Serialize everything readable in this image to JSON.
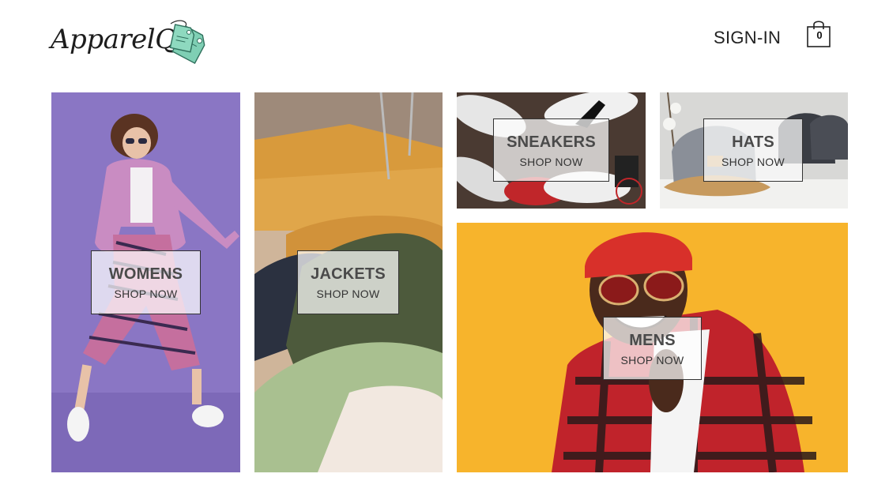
{
  "header": {
    "logo_text": "ApparelQ",
    "signin_label": "SIGN-IN",
    "cart_count": "0"
  },
  "categories": [
    {
      "title": "WOMENS",
      "cta": "SHOP NOW"
    },
    {
      "title": "JACKETS",
      "cta": "SHOP NOW"
    },
    {
      "title": "SNEAKERS",
      "cta": "SHOP NOW"
    },
    {
      "title": "HATS",
      "cta": "SHOP NOW"
    },
    {
      "title": "MENS",
      "cta": "SHOP NOW"
    }
  ],
  "colors": {
    "tag_green": "#7fcfb4",
    "womens_bg": "#8a76c4",
    "mens_bg": "#f7b42c"
  }
}
